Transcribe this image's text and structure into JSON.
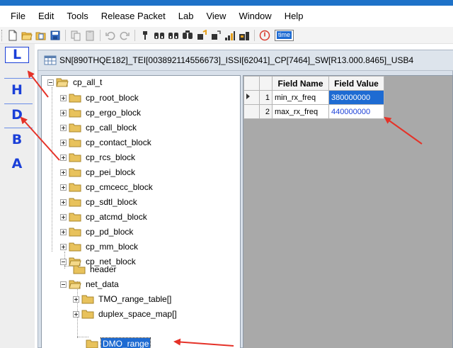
{
  "menu": [
    "File",
    "Edit",
    "Tools",
    "Release Packet",
    "Lab",
    "View",
    "Window",
    "Help"
  ],
  "toolbar": {
    "icons": [
      "new-file-icon",
      "open-folder-icon",
      "open-recent-icon",
      "save-icon",
      "copy-icon",
      "paste-icon",
      "undo-icon",
      "redo-icon",
      "pin-icon",
      "binoculars-icon",
      "binoculars-next-icon",
      "binoculars-all-icon",
      "device-icon",
      "device-alt-icon",
      "signal-icon",
      "signal-alt-icon",
      "stop-icon"
    ],
    "time_field": "time"
  },
  "left_rail": [
    "L",
    "H",
    "D",
    "B",
    "A"
  ],
  "window": {
    "title": "SN[890THQE182]_TEI[003892114556673]_ISSI[62041]_CP[7464]_SW[R13.000.8465]_USB4"
  },
  "tree": {
    "root": "cp_all_t",
    "blocks": [
      "cp_root_block",
      "cp_ergo_block",
      "cp_call_block",
      "cp_contact_block",
      "cp_rcs_block",
      "cp_pei_block",
      "cp_cmcecc_block",
      "cp_sdtl_block",
      "cp_atcmd_block",
      "cp_pd_block",
      "cp_mm_block",
      "cp_net_block"
    ],
    "net_children": [
      "header",
      "net_data"
    ],
    "net_data_children": [
      "TMO_range_table[]",
      "duplex_space_map[]",
      "DMO_range"
    ]
  },
  "grid": {
    "columns": [
      "Field Name",
      "Field Value"
    ],
    "rows": [
      {
        "num": "1",
        "name": "min_rx_freq",
        "value": "380000000"
      },
      {
        "num": "2",
        "name": "max_rx_freq",
        "value": "440000000"
      }
    ]
  },
  "colors": {
    "accent": "#1e72c8",
    "selection": "#1e6bd2",
    "rail_letter": "#1a3fd8",
    "annotation_arrow": "#e53228"
  }
}
